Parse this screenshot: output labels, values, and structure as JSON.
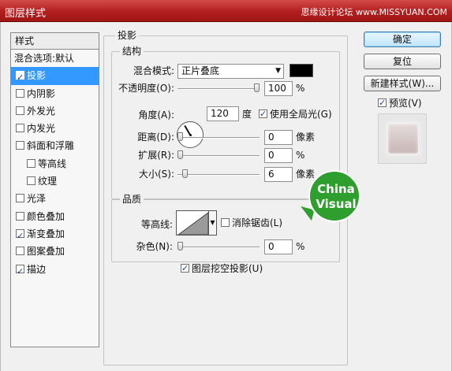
{
  "window": {
    "title": "图层样式",
    "watermark": "思缘设计论坛 www.MISSYUAN.COM"
  },
  "style_list": {
    "header": "样式",
    "blend_options": "混合选项:默认",
    "items": [
      {
        "label": "投影",
        "checked": true,
        "selected": true,
        "indent": false
      },
      {
        "label": "内阴影",
        "checked": false,
        "selected": false,
        "indent": false
      },
      {
        "label": "外发光",
        "checked": false,
        "selected": false,
        "indent": false
      },
      {
        "label": "内发光",
        "checked": false,
        "selected": false,
        "indent": false
      },
      {
        "label": "斜面和浮雕",
        "checked": false,
        "selected": false,
        "indent": false
      },
      {
        "label": "等高线",
        "checked": false,
        "selected": false,
        "indent": true
      },
      {
        "label": "纹理",
        "checked": false,
        "selected": false,
        "indent": true
      },
      {
        "label": "光泽",
        "checked": false,
        "selected": false,
        "indent": false
      },
      {
        "label": "颜色叠加",
        "checked": false,
        "selected": false,
        "indent": false
      },
      {
        "label": "渐变叠加",
        "checked": true,
        "selected": false,
        "indent": false
      },
      {
        "label": "图案叠加",
        "checked": false,
        "selected": false,
        "indent": false
      },
      {
        "label": "描边",
        "checked": true,
        "selected": false,
        "indent": false
      }
    ]
  },
  "drop_shadow": {
    "section_title": "投影",
    "structure": {
      "title": "结构",
      "blend_mode_label": "混合模式:",
      "blend_mode_value": "正片叠底",
      "shadow_color": "#000000",
      "opacity_label": "不透明度(O):",
      "opacity_value": "100",
      "opacity_fraction": 1.0,
      "percent": "%",
      "angle_label": "角度(A):",
      "angle_value": "120",
      "angle_unit": "度",
      "global_light_label": "使用全局光(G)",
      "global_light_checked": true,
      "distance_label": "距离(D):",
      "distance_value": "0",
      "distance_unit": "像素",
      "spread_label": "扩展(R):",
      "spread_value": "0",
      "size_label": "大小(S):",
      "size_value": "6",
      "size_unit": "像素"
    },
    "quality": {
      "title": "品质",
      "contour_label": "等高线:",
      "anti_alias_label": "消除锯齿(L)",
      "anti_alias_checked": false,
      "noise_label": "杂色(N):",
      "noise_value": "0",
      "percent": "%"
    },
    "knockout_label": "图层挖空投影(U)",
    "knockout_checked": true
  },
  "buttons": {
    "ok": "确定",
    "cancel": "复位",
    "new_style": "新建样式(W)...",
    "preview_label": "预览(V)",
    "preview_checked": true
  },
  "badge": {
    "line1": "China",
    "line2": "Visual"
  },
  "colors": {
    "titlebar": "#b21e1e",
    "selection": "#3399ff",
    "badge": "#2e9e2e"
  }
}
